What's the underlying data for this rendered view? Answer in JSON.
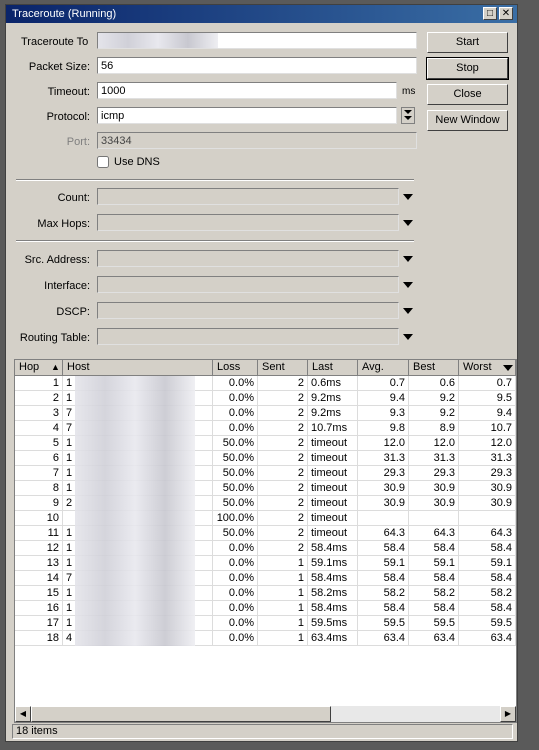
{
  "window": {
    "title": "Traceroute (Running)"
  },
  "form": {
    "traceroute_to_label": "Traceroute To",
    "packet_size_label": "Packet Size:",
    "packet_size": "56",
    "timeout_label": "Timeout:",
    "timeout": "1000",
    "timeout_unit": "ms",
    "protocol_label": "Protocol:",
    "protocol": "icmp",
    "port_label": "Port:",
    "port": "33434",
    "use_dns_label": "Use DNS",
    "count_label": "Count:",
    "max_hops_label": "Max Hops:",
    "src_address_label": "Src. Address:",
    "interface_label": "Interface:",
    "dscp_label": "DSCP:",
    "routing_table_label": "Routing Table:"
  },
  "buttons": {
    "start": "Start",
    "stop": "Stop",
    "close": "Close",
    "new_window": "New Window"
  },
  "table": {
    "columns": [
      "Hop",
      "Host",
      "Loss",
      "Sent",
      "Last",
      "Avg.",
      "Best",
      "Worst"
    ],
    "rows": [
      {
        "hop": "1",
        "host": "1",
        "loss": "0.0%",
        "sent": "2",
        "last": "0.6ms",
        "avg": "0.7",
        "best": "0.6",
        "worst": "0.7"
      },
      {
        "hop": "2",
        "host": "1",
        "loss": "0.0%",
        "sent": "2",
        "last": "9.2ms",
        "avg": "9.4",
        "best": "9.2",
        "worst": "9.5"
      },
      {
        "hop": "3",
        "host": "7",
        "loss": "0.0%",
        "sent": "2",
        "last": "9.2ms",
        "avg": "9.3",
        "best": "9.2",
        "worst": "9.4"
      },
      {
        "hop": "4",
        "host": "7",
        "loss": "0.0%",
        "sent": "2",
        "last": "10.7ms",
        "avg": "9.8",
        "best": "8.9",
        "worst": "10.7"
      },
      {
        "hop": "5",
        "host": "1",
        "loss": "50.0%",
        "sent": "2",
        "last": "timeout",
        "avg": "12.0",
        "best": "12.0",
        "worst": "12.0"
      },
      {
        "hop": "6",
        "host": "1",
        "loss": "50.0%",
        "sent": "2",
        "last": "timeout",
        "avg": "31.3",
        "best": "31.3",
        "worst": "31.3"
      },
      {
        "hop": "7",
        "host": "1",
        "loss": "50.0%",
        "sent": "2",
        "last": "timeout",
        "avg": "29.3",
        "best": "29.3",
        "worst": "29.3"
      },
      {
        "hop": "8",
        "host": "1",
        "loss": "50.0%",
        "sent": "2",
        "last": "timeout",
        "avg": "30.9",
        "best": "30.9",
        "worst": "30.9"
      },
      {
        "hop": "9",
        "host": "2",
        "loss": "50.0%",
        "sent": "2",
        "last": "timeout",
        "avg": "30.9",
        "best": "30.9",
        "worst": "30.9"
      },
      {
        "hop": "10",
        "host": "",
        "loss": "100.0%",
        "sent": "2",
        "last": "timeout",
        "avg": "",
        "best": "",
        "worst": ""
      },
      {
        "hop": "11",
        "host": "1",
        "loss": "50.0%",
        "sent": "2",
        "last": "timeout",
        "avg": "64.3",
        "best": "64.3",
        "worst": "64.3"
      },
      {
        "hop": "12",
        "host": "1",
        "loss": "0.0%",
        "sent": "2",
        "last": "58.4ms",
        "avg": "58.4",
        "best": "58.4",
        "worst": "58.4"
      },
      {
        "hop": "13",
        "host": "1",
        "loss": "0.0%",
        "sent": "1",
        "last": "59.1ms",
        "avg": "59.1",
        "best": "59.1",
        "worst": "59.1"
      },
      {
        "hop": "14",
        "host": "7",
        "loss": "0.0%",
        "sent": "1",
        "last": "58.4ms",
        "avg": "58.4",
        "best": "58.4",
        "worst": "58.4"
      },
      {
        "hop": "15",
        "host": "1",
        "loss": "0.0%",
        "sent": "1",
        "last": "58.2ms",
        "avg": "58.2",
        "best": "58.2",
        "worst": "58.2"
      },
      {
        "hop": "16",
        "host": "1",
        "loss": "0.0%",
        "sent": "1",
        "last": "58.4ms",
        "avg": "58.4",
        "best": "58.4",
        "worst": "58.4"
      },
      {
        "hop": "17",
        "host": "1",
        "loss": "0.0%",
        "sent": "1",
        "last": "59.5ms",
        "avg": "59.5",
        "best": "59.5",
        "worst": "59.5"
      },
      {
        "hop": "18",
        "host": "4",
        "loss": "0.0%",
        "sent": "1",
        "last": "63.4ms",
        "avg": "63.4",
        "best": "63.4",
        "worst": "63.4"
      }
    ]
  },
  "status": {
    "items": "18 items"
  },
  "icons": {
    "maximize": "maximize-icon",
    "close": "close-icon",
    "dropdown": "triangle-down-icon",
    "sort": "sort-arrow-icon"
  }
}
